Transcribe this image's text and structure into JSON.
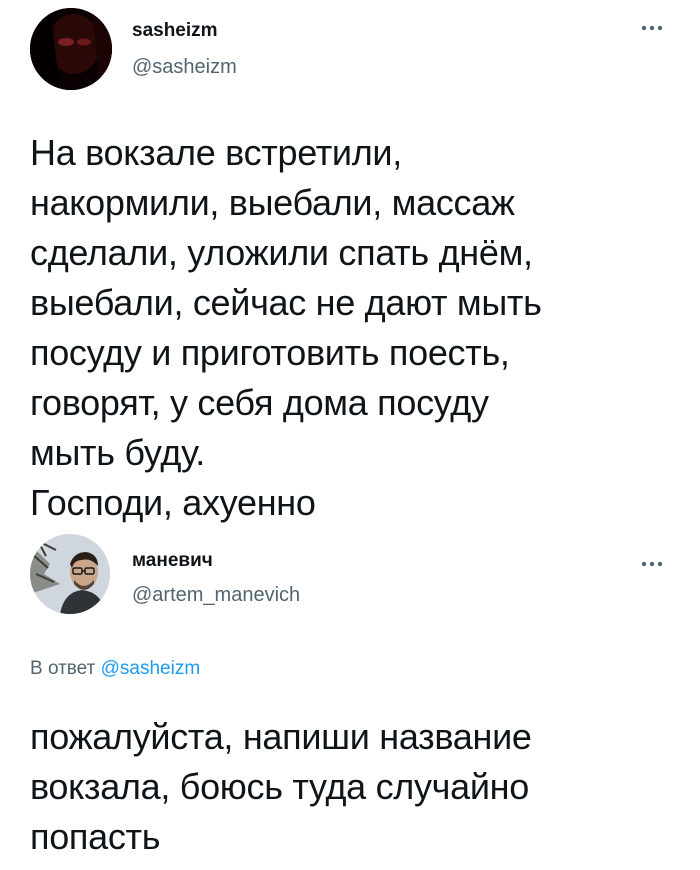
{
  "tweets": [
    {
      "avatar_icon": "profile-photo-dark",
      "display_name": "sasheizm",
      "handle": "@sasheizm",
      "more_icon": "more-dots-icon",
      "text_lines": [
        "На вокзале встретили,",
        "накормили, выебали, массаж",
        "сделали, уложили спать днём,",
        "выебали, сейчас не дают мыть",
        "посуду и приготовить поесть,",
        "говорят, у себя дома посуду",
        "мыть буду.",
        "Господи, ахуенно"
      ]
    },
    {
      "avatar_icon": "profile-photo-man-glasses",
      "display_name": "маневич",
      "handle": "@artem_manevich",
      "more_icon": "more-dots-icon",
      "reply_prefix": "В ответ",
      "reply_to": "@sasheizm",
      "text_lines": [
        "пожалуйста, напиши название",
        "вокзала, боюсь туда случайно",
        "попасть"
      ]
    }
  ],
  "colors": {
    "text": "#0f1419",
    "secondary": "#536471",
    "link": "#1d9bf0",
    "background": "#ffffff"
  }
}
